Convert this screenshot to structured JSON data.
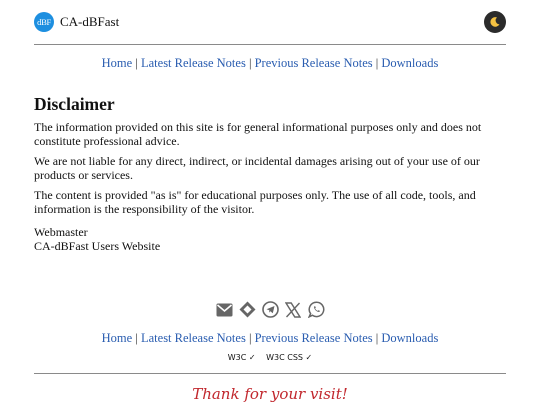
{
  "site": {
    "logo_text": "dBF",
    "name": "CA-dBFast",
    "theme_icon": "moon-icon"
  },
  "nav": {
    "home": "Home",
    "latest": "Latest Release Notes",
    "previous": "Previous Release Notes",
    "downloads": "Downloads",
    "separator": "|"
  },
  "content": {
    "heading": "Disclaimer",
    "paragraphs": [
      "The information provided on this site is for general informational purposes only and does not constitute professional advice.",
      "We are not liable for any direct, indirect, or incidental damages arising out of your use of our products or services.",
      "The content is provided \"as is\" for educational purposes only. The use of all code, tools, and information is the responsibility of the visitor."
    ],
    "signature_line1": "Webmaster",
    "signature_line2": "CA-dBFast Users Website"
  },
  "social": [
    "email-icon",
    "diamond-icon",
    "telegram-icon",
    "x-icon",
    "whatsapp-icon"
  ],
  "validators": {
    "w3c": "W3C ✓",
    "css": "W3C CSS ✓"
  },
  "footer": {
    "thanks": "Thank for your visit!"
  },
  "colors": {
    "link": "#2a5db0",
    "logo": "#1d8fe0",
    "thanks": "#c1272d"
  }
}
